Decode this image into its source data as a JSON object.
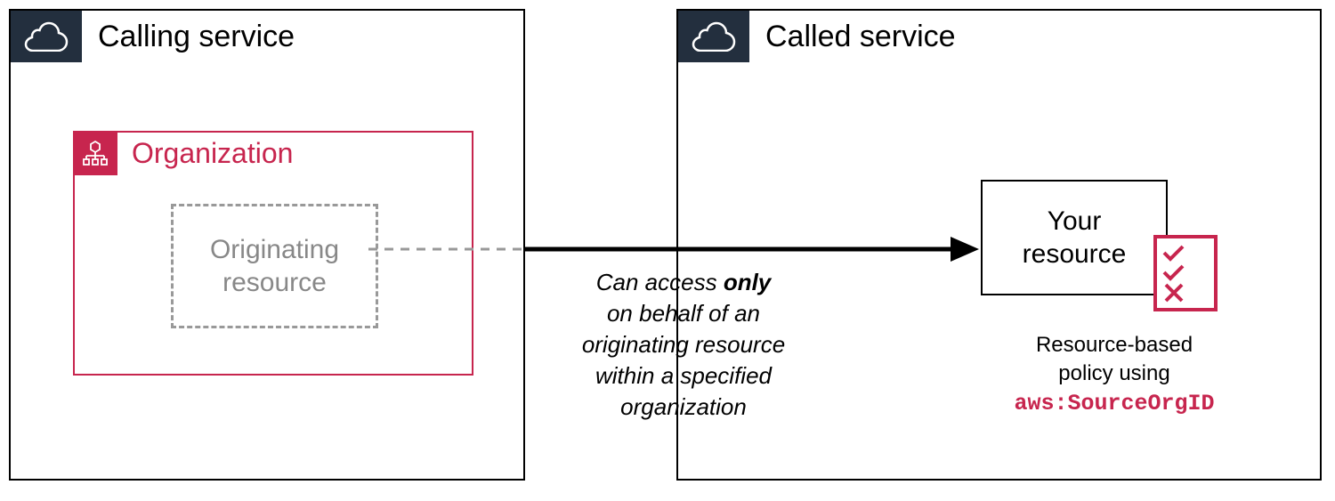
{
  "calling_service": {
    "title": "Calling service",
    "organization": {
      "title": "Organization",
      "originating": "Originating\nresource"
    }
  },
  "called_service": {
    "title": "Called service",
    "your_resource": "Your\nresource",
    "policy_text_1": "Resource-based",
    "policy_text_2": "policy using",
    "policy_code": "aws:SourceOrgID"
  },
  "arrow_label_pre": "Can access ",
  "arrow_label_bold": "only",
  "arrow_label_rest": "\non behalf of an\noriginating resource\nwithin a specified\norganization"
}
